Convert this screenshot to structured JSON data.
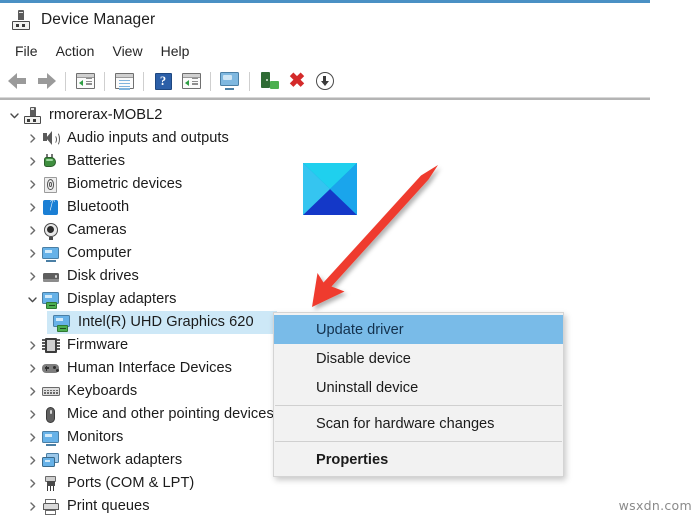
{
  "window": {
    "title": "Device Manager",
    "title_icon": "device-manager-icon"
  },
  "menubar": {
    "items": [
      {
        "label": "File"
      },
      {
        "label": "Action"
      },
      {
        "label": "View"
      },
      {
        "label": "Help"
      }
    ]
  },
  "toolbar": {
    "buttons": [
      {
        "name": "back-arrow-icon",
        "tooltip": "Back"
      },
      {
        "name": "forward-arrow-icon",
        "tooltip": "Forward"
      },
      {
        "name": "show-hide-console-tree-icon",
        "tooltip": "Show/Hide Console Tree"
      },
      {
        "name": "properties-icon",
        "tooltip": "Properties"
      },
      {
        "name": "help-icon",
        "tooltip": "Help"
      },
      {
        "name": "show-hide-action-pane-icon",
        "tooltip": "Show/Hide Action Pane"
      },
      {
        "name": "update-driver-icon",
        "tooltip": "Update Driver Software"
      },
      {
        "name": "scan-for-hardware-changes-icon",
        "tooltip": "Scan for hardware changes"
      },
      {
        "name": "uninstall-device-icon",
        "tooltip": "Uninstall device"
      },
      {
        "name": "disable-device-icon",
        "tooltip": "Disable device"
      }
    ]
  },
  "tree": {
    "root": {
      "label": "rmorerax-MOBL2",
      "icon": "computer-icon",
      "expanded": true,
      "level": 1
    },
    "items": [
      {
        "label": "Audio inputs and outputs",
        "icon": "speaker-icon",
        "expanded": false,
        "level": 2,
        "selected": false
      },
      {
        "label": "Batteries",
        "icon": "battery-icon",
        "expanded": false,
        "level": 2,
        "selected": false
      },
      {
        "label": "Biometric devices",
        "icon": "fingerprint-icon",
        "expanded": false,
        "level": 2,
        "selected": false
      },
      {
        "label": "Bluetooth",
        "icon": "bluetooth-icon",
        "expanded": false,
        "level": 2,
        "selected": false
      },
      {
        "label": "Cameras",
        "icon": "camera-icon",
        "expanded": false,
        "level": 2,
        "selected": false
      },
      {
        "label": "Computer",
        "icon": "monitor-icon",
        "expanded": false,
        "level": 2,
        "selected": false
      },
      {
        "label": "Disk drives",
        "icon": "disk-icon",
        "expanded": false,
        "level": 2,
        "selected": false
      },
      {
        "label": "Display adapters",
        "icon": "display-adapter-icon",
        "expanded": true,
        "level": 2,
        "selected": false
      },
      {
        "label": "Intel(R) UHD Graphics 620",
        "icon": "display-adapter-icon",
        "expanded": null,
        "level": 3,
        "selected": true
      },
      {
        "label": "Firmware",
        "icon": "firmware-icon",
        "expanded": false,
        "level": 2,
        "selected": false
      },
      {
        "label": "Human Interface Devices",
        "icon": "hid-icon",
        "expanded": false,
        "level": 2,
        "selected": false
      },
      {
        "label": "Keyboards",
        "icon": "keyboard-icon",
        "expanded": false,
        "level": 2,
        "selected": false
      },
      {
        "label": "Mice and other pointing devices",
        "icon": "mouse-icon",
        "expanded": false,
        "level": 2,
        "selected": false
      },
      {
        "label": "Monitors",
        "icon": "monitor-icon",
        "expanded": false,
        "level": 2,
        "selected": false
      },
      {
        "label": "Network adapters",
        "icon": "network-icon",
        "expanded": false,
        "level": 2,
        "selected": false
      },
      {
        "label": "Ports (COM & LPT)",
        "icon": "port-icon",
        "expanded": false,
        "level": 2,
        "selected": false
      },
      {
        "label": "Print queues",
        "icon": "printer-icon",
        "expanded": false,
        "level": 2,
        "selected": false
      }
    ]
  },
  "context_menu": {
    "items": [
      {
        "label": "Update driver",
        "highlighted": true,
        "bold": false,
        "separator_after": false
      },
      {
        "label": "Disable device",
        "highlighted": false,
        "bold": false,
        "separator_after": false
      },
      {
        "label": "Uninstall device",
        "highlighted": false,
        "bold": false,
        "separator_after": true
      },
      {
        "label": "Scan for hardware changes",
        "highlighted": false,
        "bold": false,
        "separator_after": true
      },
      {
        "label": "Properties",
        "highlighted": false,
        "bold": true,
        "separator_after": false
      }
    ]
  },
  "annotations": {
    "arrow": {
      "name": "red-pointer-arrow",
      "color": "#ef3b2d",
      "points_to": "Update driver"
    },
    "logo": {
      "name": "blue-x-logo",
      "colors": [
        "#1fd0ee",
        "#35c5f0",
        "#1aa5ec",
        "#1438c8"
      ]
    }
  },
  "watermark": {
    "text": "wsxdn.com"
  },
  "colors": {
    "title_accent": "#4a90c4",
    "selection": "#cde8f7",
    "menu_highlight": "#79bbe8",
    "menu_background": "#f2f2f2"
  }
}
